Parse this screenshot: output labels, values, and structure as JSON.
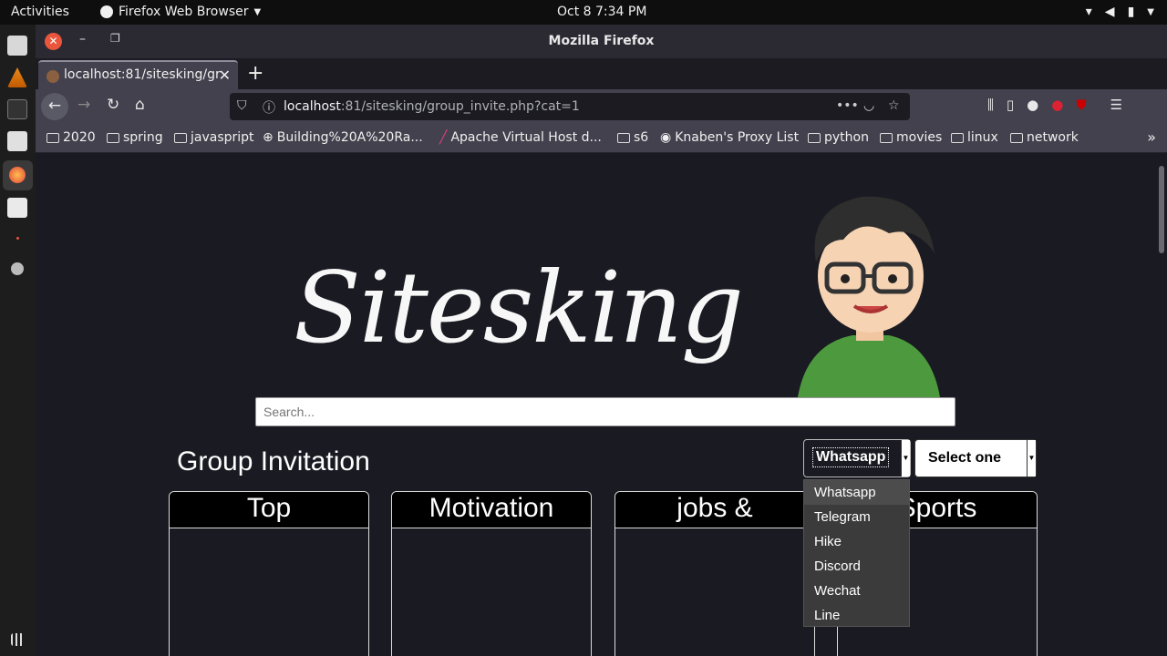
{
  "topbar": {
    "activities": "Activities",
    "app_name": "Firefox Web Browser",
    "clock": "Oct 8   7:34 PM"
  },
  "window": {
    "title": "Mozilla Firefox"
  },
  "tab": {
    "title": "localhost:81/sitesking/gr"
  },
  "urlbar": {
    "host": "localhost",
    "rest": ":81/sitesking/group_invite.php?cat=1"
  },
  "bookmarks": [
    {
      "label": "2020",
      "icon": "folder-icon"
    },
    {
      "label": "spring",
      "icon": "folder-icon"
    },
    {
      "label": "javaspript",
      "icon": "folder-icon"
    },
    {
      "label": "Building%20A%20Ra...",
      "icon": "globe-icon"
    },
    {
      "label": "Apache Virtual Host d...",
      "icon": "feather-icon"
    },
    {
      "label": "s6",
      "icon": "folder-icon"
    },
    {
      "label": "Knaben's Proxy List",
      "icon": "site-icon"
    },
    {
      "label": "python",
      "icon": "folder-icon"
    },
    {
      "label": "movies",
      "icon": "folder-icon"
    },
    {
      "label": "linux",
      "icon": "folder-icon"
    },
    {
      "label": "network",
      "icon": "folder-icon"
    }
  ],
  "page": {
    "logo": "Sitesking",
    "search_placeholder": "Search...",
    "heading": "Group Invitation",
    "app_select": "Whatsapp",
    "category_select": "Select one",
    "cards": [
      {
        "title": "Top"
      },
      {
        "title": "Motivation"
      },
      {
        "title": "jobs &"
      },
      {
        "title": "Sports"
      }
    ],
    "dropdown_options": [
      "Whatsapp",
      "Telegram",
      "Hike",
      "Discord",
      "Wechat",
      "Line"
    ]
  },
  "colors": {
    "page_bg": "#1a1a22",
    "toolbar_bg": "#42414d",
    "close_button": "#e9563c"
  }
}
